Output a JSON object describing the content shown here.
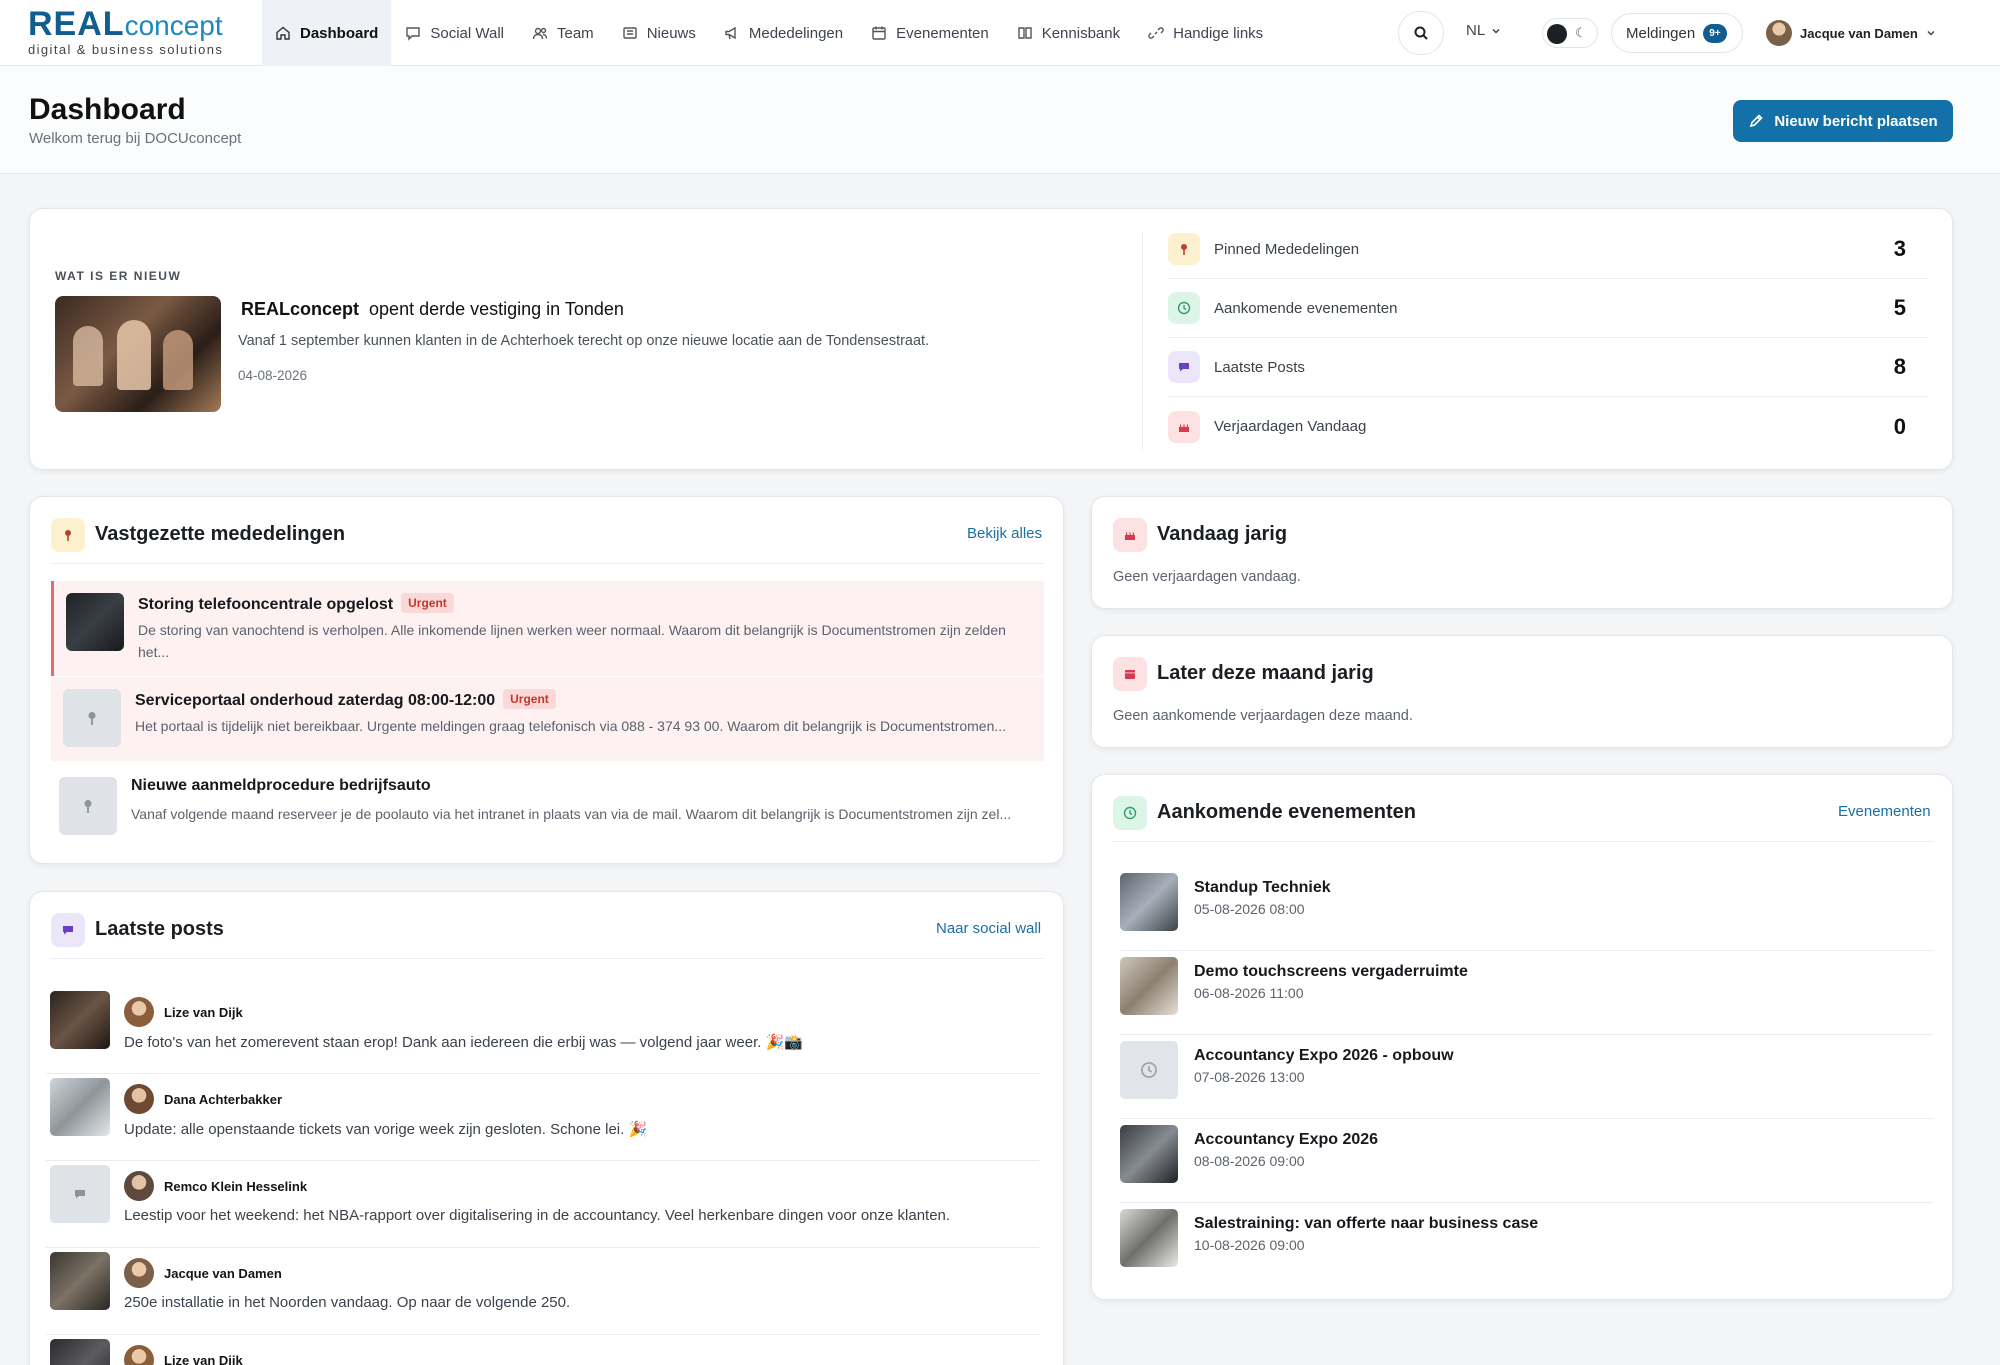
{
  "brand": {
    "name_strong": "REAL",
    "name_light": "concept",
    "tagline": "digital & business solutions"
  },
  "nav": {
    "items": [
      {
        "label": "Dashboard"
      },
      {
        "label": "Social Wall"
      },
      {
        "label": "Team"
      },
      {
        "label": "Nieuws"
      },
      {
        "label": "Mededelingen"
      },
      {
        "label": "Evenementen"
      },
      {
        "label": "Kennisbank"
      },
      {
        "label": "Handige links"
      }
    ],
    "language": "NL",
    "notifications_label": "Meldingen",
    "notifications_badge": "9+",
    "user_name": "Jacque van Damen"
  },
  "header": {
    "title": "Dashboard",
    "subtitle": "Welkom terug bij DOCUconcept",
    "new_post_label": "Nieuw bericht plaatsen"
  },
  "whats_new": {
    "overline": "WAT IS ER NIEUW",
    "title_brand": "REALconcept",
    "title_rest": "opent derde vestiging in Tonden",
    "description": "Vanaf 1 september kunnen klanten in de Achterhoek terecht op onze nieuwe locatie aan de Tondensestraat.",
    "date": "04-08-2026"
  },
  "stats": [
    {
      "label": "Pinned Mededelingen",
      "value": "3",
      "color": "#fdf0cf",
      "icon_color": "#b5412f"
    },
    {
      "label": "Aankomende evenementen",
      "value": "5",
      "color": "#dcf5e6",
      "icon_color": "#2f9e68"
    },
    {
      "label": "Laatste Posts",
      "value": "8",
      "color": "#ece6fb",
      "icon_color": "#6a3fc7"
    },
    {
      "label": "Verjaardagen Vandaag",
      "value": "0",
      "color": "#fde1e3",
      "icon_color": "#d63a53"
    }
  ],
  "pinned": {
    "title": "Vastgezette mededelingen",
    "link": "Bekijk alles",
    "items": [
      {
        "title": "Storing telefooncentrale opgelost",
        "tag": "Urgent",
        "desc1": "De storing van vanochtend is verholpen. Alle inkomende lijnen werken weer normaal. Waarom dit belangrijk is Documentstromen zijn zelden",
        "desc2": "het..."
      },
      {
        "title": "Serviceportaal onderhoud zaterdag 08:00-12:00",
        "tag": "Urgent",
        "desc1": "Het portaal is tijdelijk niet bereikbaar. Urgente meldingen graag telefonisch via 088 - 374 93 00. Waarom dit belangrijk is Documentstromen..."
      },
      {
        "title": "Nieuwe aanmeldprocedure bedrijfsauto",
        "desc1": "Vanaf volgende maand reserveer je de poolauto via het intranet in plaats van via de mail. Waarom dit belangrijk is Documentstromen zijn zel..."
      }
    ]
  },
  "posts": {
    "title": "Laatste posts",
    "link": "Naar social wall",
    "items": [
      {
        "name": "Lize van Dijk",
        "text": "De foto's van het zomerevent staan erop! Dank aan iedereen die erbij was — volgend jaar weer. 🎉📸"
      },
      {
        "name": "Dana Achterbakker",
        "text": "Update: alle openstaande tickets van vorige week zijn gesloten. Schone lei. 🎉"
      },
      {
        "name": "Remco Klein Hesselink",
        "text": "Leestip voor het weekend: het NBA-rapport over digitalisering in de accountancy. Veel herkenbare dingen voor onze klanten."
      },
      {
        "name": "Jacque van Damen",
        "text": "250e installatie in het Noorden vandaag. Op naar de volgende 250."
      },
      {
        "name": "Lize van Dijk",
        "text": ""
      }
    ]
  },
  "birthday_today": {
    "title": "Vandaag jarig",
    "empty": "Geen verjaardagen vandaag."
  },
  "birthday_month": {
    "title": "Later deze maand jarig",
    "empty": "Geen aankomende verjaardagen deze maand."
  },
  "events": {
    "title": "Aankomende evenementen",
    "link": "Evenementen",
    "items": [
      {
        "title": "Standup Techniek",
        "date": "05-08-2026 08:00"
      },
      {
        "title": "Demo touchscreens vergaderruimte",
        "date": "06-08-2026 11:00"
      },
      {
        "title": "Accountancy Expo 2026 - opbouw",
        "date": "07-08-2026 13:00"
      },
      {
        "title": "Accountancy Expo 2026",
        "date": "08-08-2026 09:00"
      },
      {
        "title": "Salestraining: van offerte naar business case",
        "date": "10-08-2026 09:00"
      }
    ]
  }
}
